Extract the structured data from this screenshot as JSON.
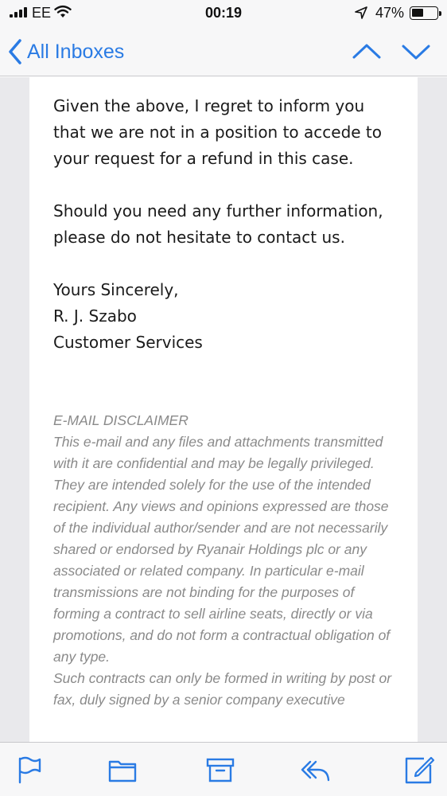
{
  "status_bar": {
    "carrier": "EE",
    "time": "00:19",
    "battery": "47%",
    "battery_level": 0.47,
    "icons": [
      "signal-icon",
      "wifi-icon",
      "location-arrow-icon",
      "battery-icon"
    ]
  },
  "nav": {
    "back_label": "All Inboxes",
    "icons": [
      "chevron-left-icon",
      "chevron-up-icon",
      "chevron-down-icon"
    ],
    "accent_color": "#2a7be4"
  },
  "email": {
    "paragraphs": [
      "Given the above, I regret to inform you that we are not in a position to accede to your request for a refund in this case.",
      "Should you need any further information, please do not hesitate to contact us."
    ],
    "signoff": [
      "Yours Sincerely,",
      "R. J. Szabo",
      "Customer Services"
    ],
    "disclaimer": {
      "title": "E-MAIL DISCLAIMER",
      "text": "This e-mail and any files and attachments transmitted with it are confidential and may be legally privileged. They are intended solely for the use of the intended recipient. Any views and opinions expressed are those of the individual author/sender and are not necessarily shared or endorsed by Ryanair Holdings plc or any associated or related company. In particular e-mail transmissions are not binding for the purposes of forming a contract to sell airline seats, directly or via promotions, and do not form a contractual obligation of any type.",
      "text2": "Such contracts can only be formed in writing by post or fax, duly signed by a senior company executive"
    }
  },
  "toolbar": {
    "icons": [
      "flag-icon",
      "folder-icon",
      "archive-icon",
      "reply-icon",
      "compose-icon"
    ]
  }
}
